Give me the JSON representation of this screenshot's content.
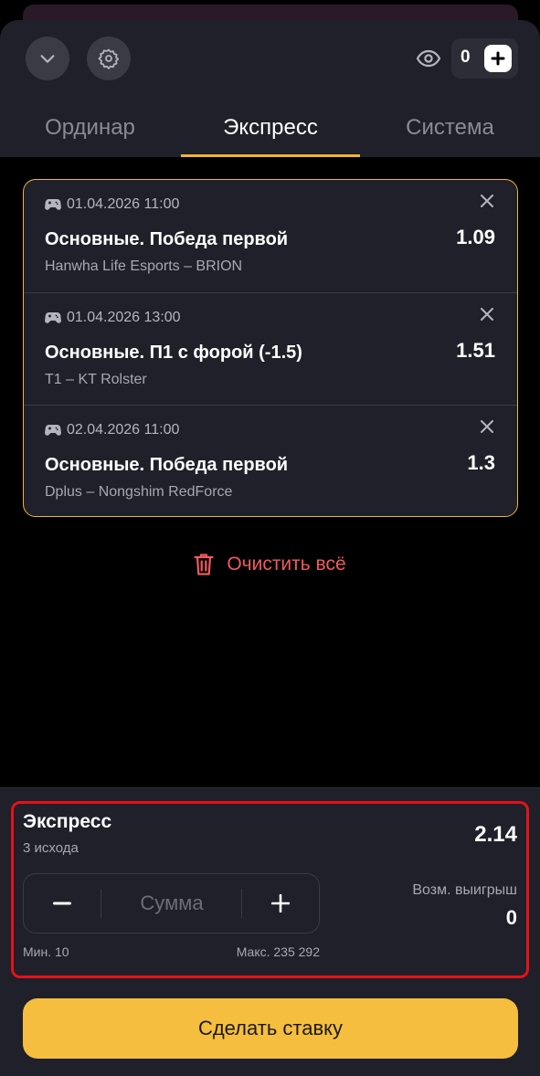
{
  "header": {
    "collapse_icon": "chevron-down-icon",
    "settings_icon": "gear-icon",
    "visibility_icon": "eye-icon",
    "balance": "0",
    "add_icon": "plus-icon"
  },
  "tabs": [
    {
      "label": "Ординар",
      "active": false
    },
    {
      "label": "Экспресс",
      "active": true
    },
    {
      "label": "Система",
      "active": false
    }
  ],
  "accent_color": "#f2b531",
  "bets": [
    {
      "datetime": "01.04.2026 11:00",
      "market": "Основные. Победа первой",
      "teams": "Hanwha Life Esports – BRION",
      "odds": "1.09"
    },
    {
      "datetime": "01.04.2026 13:00",
      "market": "Основные. П1 с форой (-1.5)",
      "teams": "T1 – KT Rolster",
      "odds": "1.51"
    },
    {
      "datetime": "02.04.2026 11:00",
      "market": "Основные. Победа первой",
      "teams": "Dplus – Nongshim RedForce",
      "odds": "1.3"
    }
  ],
  "clear_all": {
    "label": "Очистить всё",
    "icon": "trash-icon",
    "color": "#ef5a5e"
  },
  "express": {
    "title": "Экспресс",
    "outcomes": "3 исхода",
    "total_odds": "2.14",
    "stake_placeholder": "Сумма",
    "min": "Мин. 10",
    "max": "Макс. 235 292",
    "possible_win_label": "Возм. выигрыш",
    "possible_win_value": "0"
  },
  "submit_label": "Сделать ставку"
}
